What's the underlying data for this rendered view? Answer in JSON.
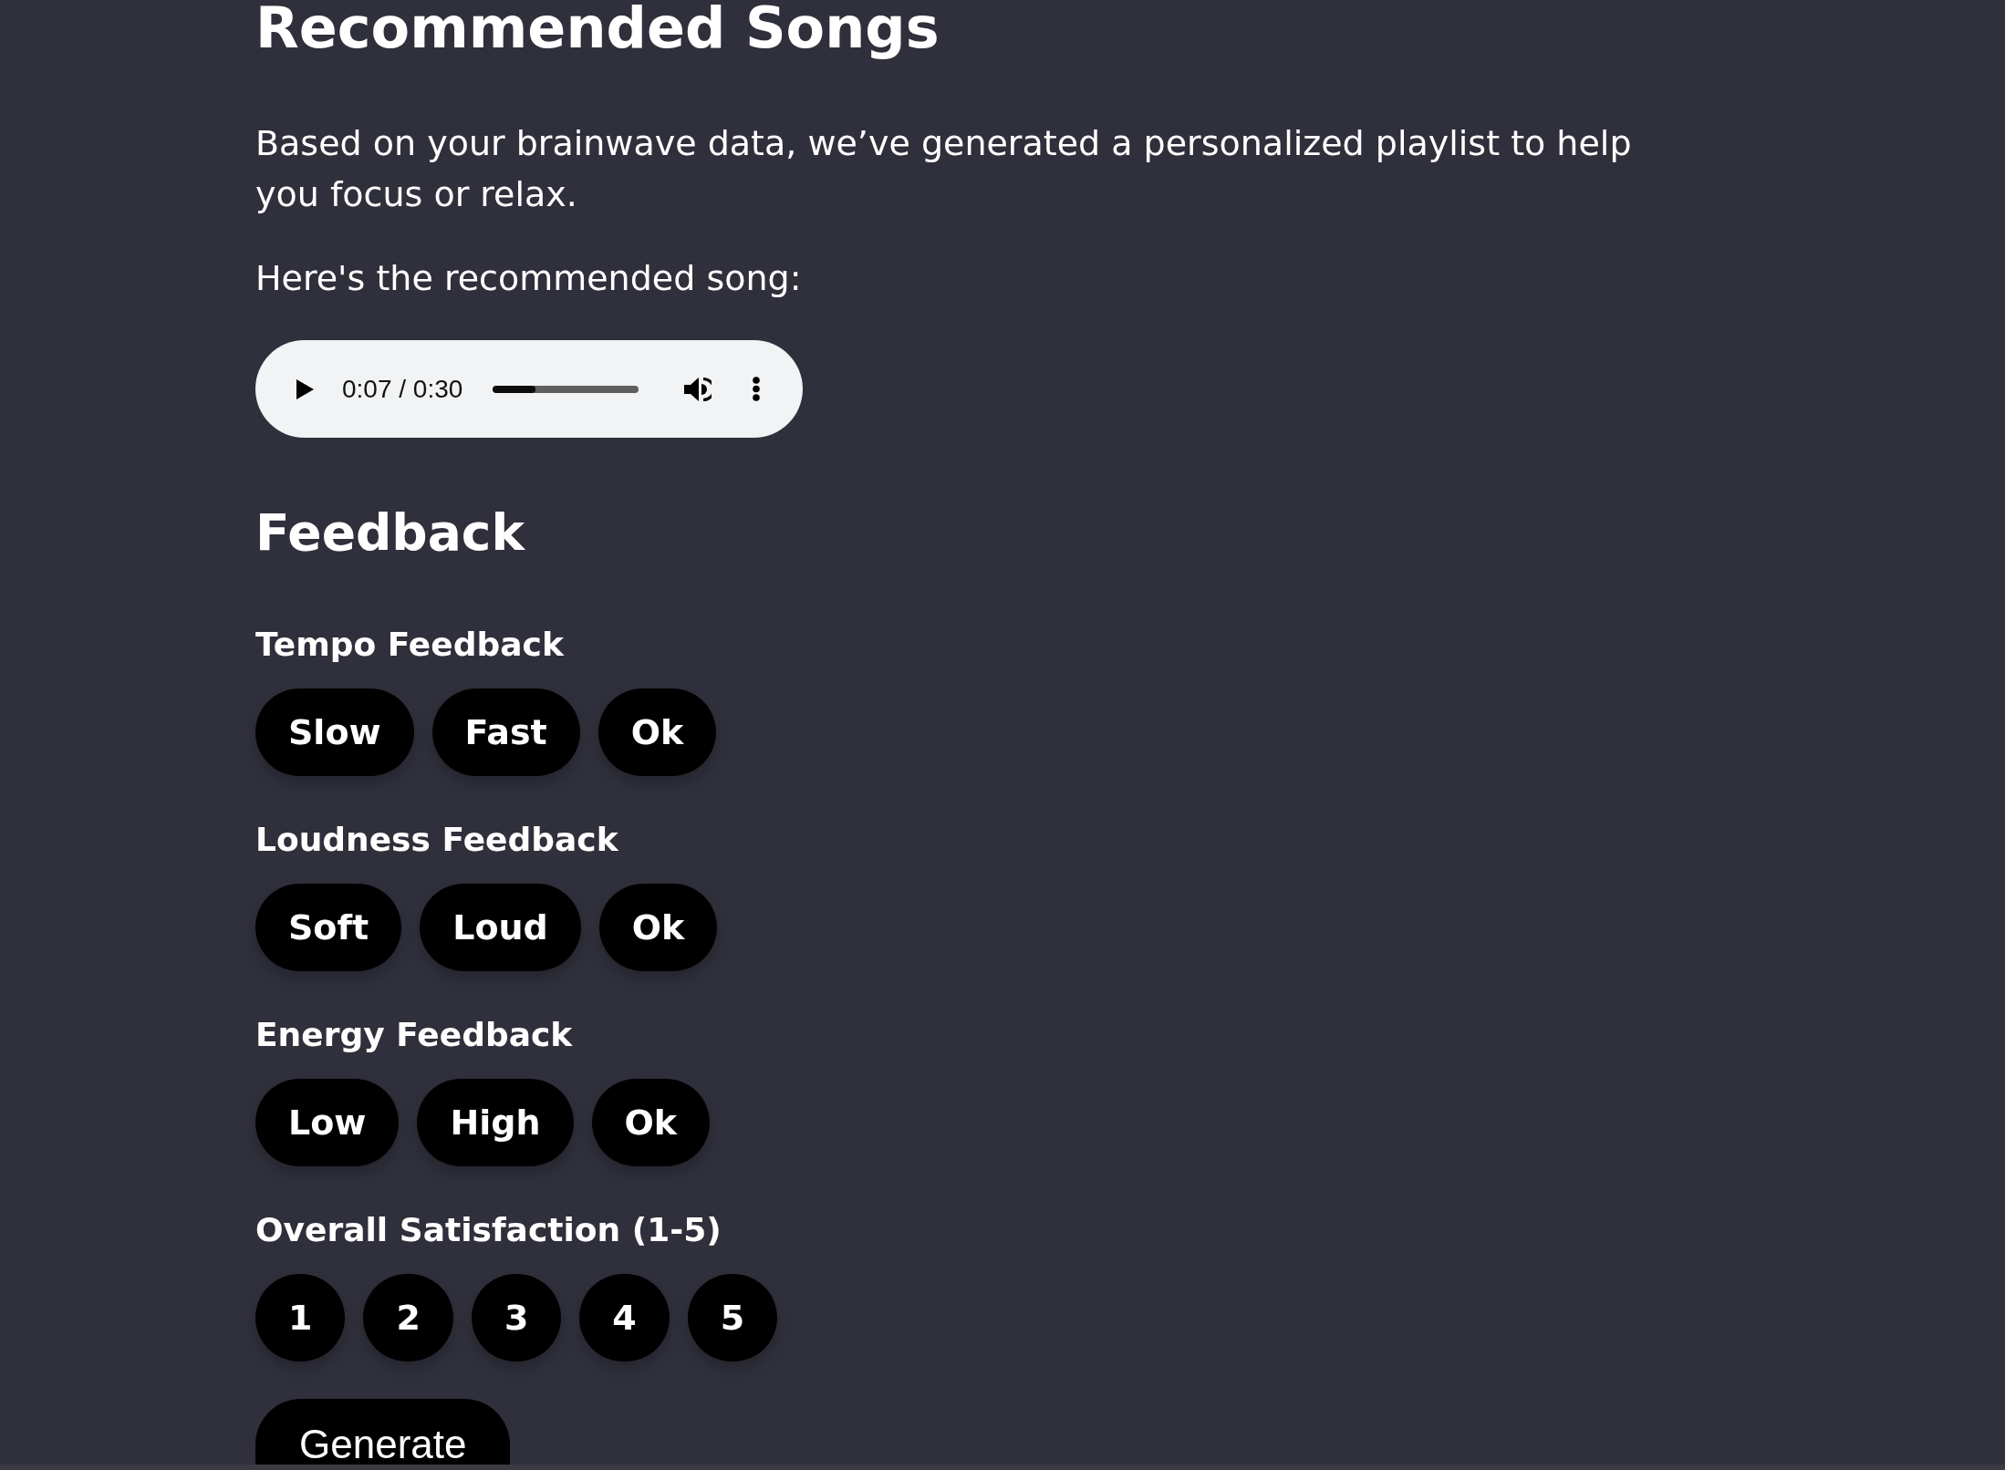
{
  "title": "Recommended Songs",
  "intro": "Based on your brainwave data, we’ve generated a personalized playlist to help you focus or relax.",
  "song_prompt": "Here's the recommended song:",
  "audio_player": {
    "time": "0:07 / 0:30",
    "level": 0.29
  },
  "feedback": {
    "title": "Feedback",
    "groups": [
      {
        "label": "Tempo Feedback",
        "options": [
          "Slow",
          "Fast",
          "Ok"
        ]
      },
      {
        "label": "Loudness Feedback",
        "options": [
          "Soft",
          "Loud",
          "Ok"
        ]
      },
      {
        "label": "Energy Feedback",
        "options": [
          "Low",
          "High",
          "Ok"
        ]
      },
      {
        "label": "Overall Satisfaction (1-5)",
        "options": [
          "1",
          "2",
          "3",
          "4",
          "5"
        ]
      }
    ]
  },
  "generate_button": "Generate"
}
